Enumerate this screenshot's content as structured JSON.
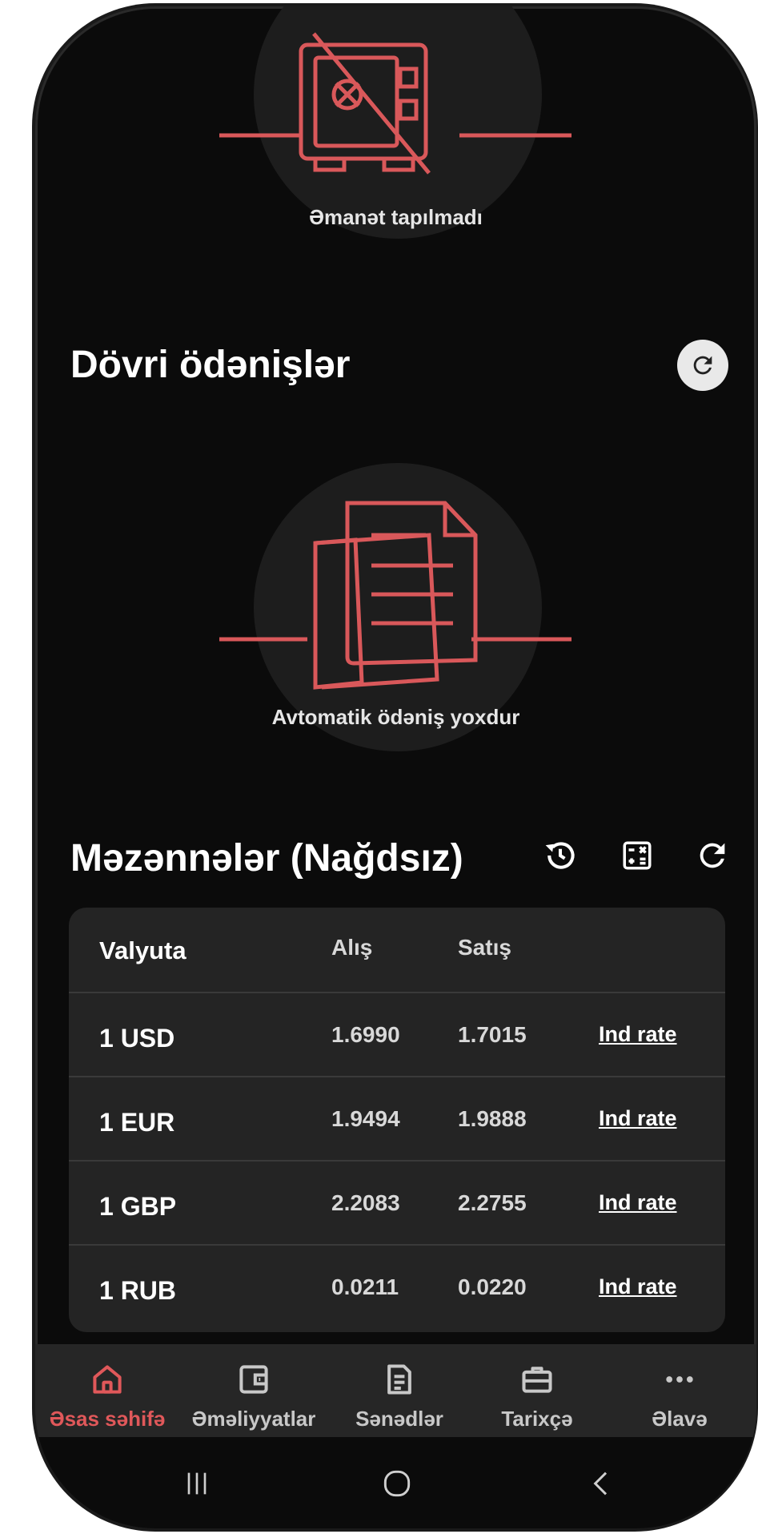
{
  "deposits": {
    "empty_text": "Əmanət tapılmadı"
  },
  "recurring": {
    "title": "Dövri ödənişlər",
    "empty_text": "Avtomatik ödəniş yoxdur"
  },
  "rates": {
    "title": "Məzənnələr (Nağdsız)",
    "columns": {
      "currency": "Valyuta",
      "buy": "Alış",
      "sell": "Satış"
    },
    "rows": [
      {
        "currency": "1 USD",
        "buy": "1.6990",
        "sell": "1.7015",
        "link": "Ind rate"
      },
      {
        "currency": "1 EUR",
        "buy": "1.9494",
        "sell": "1.9888",
        "link": "Ind rate"
      },
      {
        "currency": "1 GBP",
        "buy": "2.2083",
        "sell": "2.2755",
        "link": "Ind rate"
      },
      {
        "currency": "1 RUB",
        "buy": "0.0211",
        "sell": "0.0220",
        "link": "Ind rate"
      }
    ]
  },
  "tabs": [
    {
      "label": "Əsas səhifə",
      "icon": "home-icon",
      "active": true
    },
    {
      "label": "Əməliyyatlar",
      "icon": "wallet-icon",
      "active": false
    },
    {
      "label": "Sənədlər",
      "icon": "document-icon",
      "active": false
    },
    {
      "label": "Tarixçə",
      "icon": "briefcase-icon",
      "active": false
    },
    {
      "label": "Əlavə",
      "icon": "more-icon",
      "active": false
    }
  ],
  "colors": {
    "accent": "#e0585a",
    "background": "#0b0b0b",
    "card": "#242424"
  }
}
